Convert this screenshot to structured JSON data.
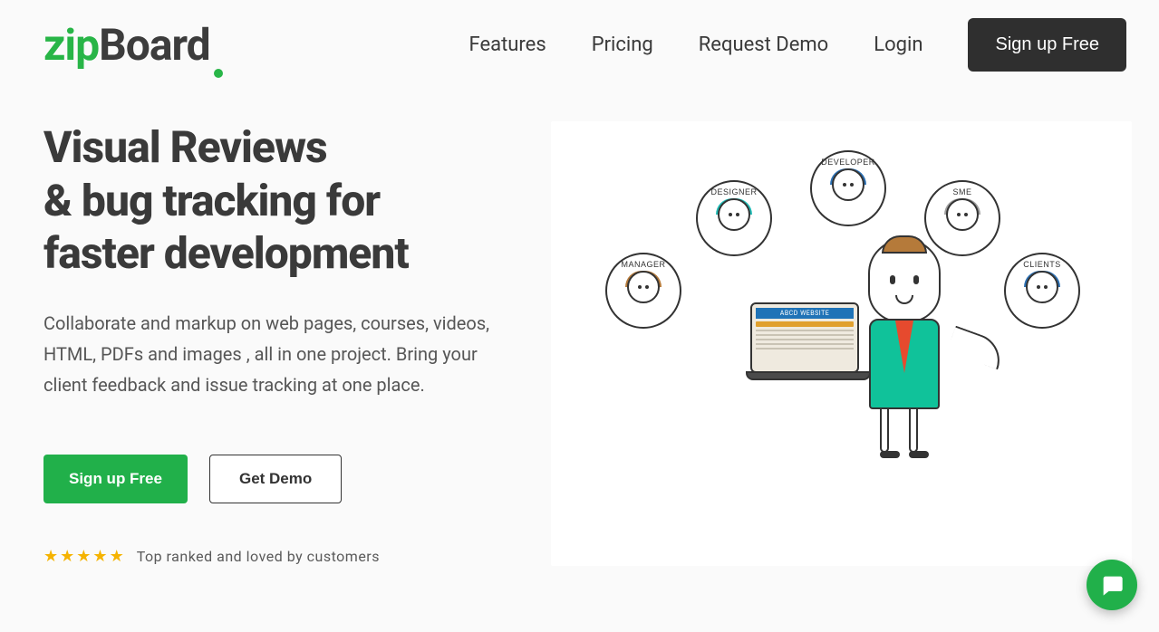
{
  "brand": {
    "part1": "zip",
    "part2": "Board"
  },
  "nav": {
    "items": [
      "Features",
      "Pricing",
      "Request Demo",
      "Login"
    ],
    "signup": "Sign up Free"
  },
  "hero": {
    "title_line1": "Visual Reviews",
    "title_line2": "& bug tracking for",
    "title_line3": "faster development",
    "subtitle": "Collaborate and markup on web pages, courses, videos, HTML, PDFs and images , all in one project. Bring your client feedback and issue tracking at one place.",
    "cta_primary": "Sign up Free",
    "cta_secondary": "Get Demo",
    "rating_text": "Top ranked and loved by customers",
    "stars": 5
  },
  "illustration": {
    "roles": {
      "manager": "MANAGER",
      "designer": "DESIGNER",
      "developer": "DEVELOPER",
      "sme": "SME",
      "clients": "CLIENTS"
    },
    "laptop_label": "ABCD WEBSITE"
  }
}
